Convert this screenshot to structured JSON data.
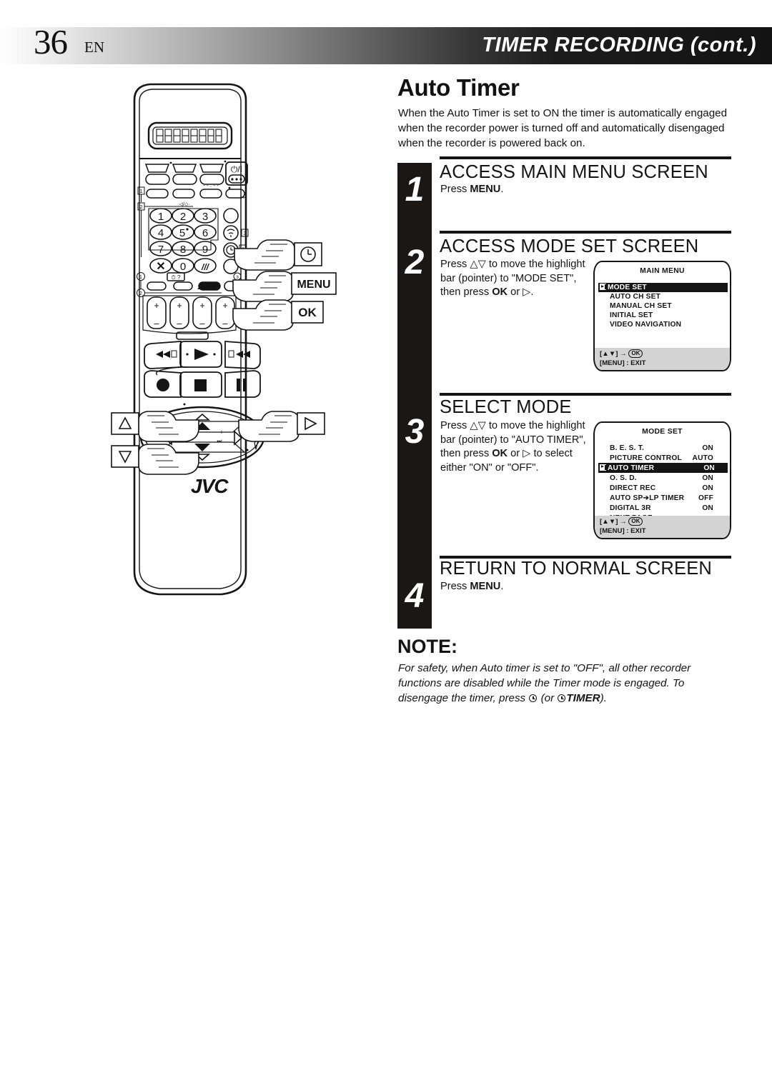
{
  "header": {
    "page_number": "36",
    "language": "EN",
    "title": "TIMER RECORDING (cont.)"
  },
  "section": {
    "title": "Auto Timer",
    "intro": "When the Auto Timer is set to ON the timer is automatically engaged when the recorder power is turned off and automatically disengaged when the recorder is powered back on."
  },
  "steps": [
    {
      "number": "1",
      "heading": "ACCESS MAIN MENU SCREEN",
      "body_html": "Press <b>MENU</b>."
    },
    {
      "number": "2",
      "heading": "ACCESS MODE SET SCREEN",
      "body_html": "Press &#9651;&#9661; to move the highlight bar (pointer) to \"MODE SET\", then press <b>OK</b> or &#9655;."
    },
    {
      "number": "3",
      "heading": "SELECT MODE",
      "body_html": "Press &#9651;&#9661; to move the highlight bar (pointer) to \"AUTO TIMER\", then press <b>OK</b> or &#9655; to select either \"ON\" or \"OFF\"."
    },
    {
      "number": "4",
      "heading": "RETURN TO NORMAL SCREEN",
      "body_html": "Press <b>MENU</b>."
    }
  ],
  "note": {
    "label": "NOTE:",
    "body_html": "For safety, when Auto timer is set to \"OFF\", all other recorder functions are disabled while the Timer mode is engaged. To disengage the timer, press <span class=\"inline-clock\"></span> (or <span class=\"inline-clock\"></span><b>TIMER</b>)."
  },
  "osd_screens": [
    {
      "id": "main-menu",
      "title": "MAIN MENU",
      "rows": [
        {
          "label": "MODE SET",
          "value": "",
          "highlight": true,
          "pointer": true
        },
        {
          "label": "AUTO CH SET",
          "value": "",
          "highlight": false
        },
        {
          "label": "MANUAL CH SET",
          "value": "",
          "highlight": false
        },
        {
          "label": "INITIAL SET",
          "value": "",
          "highlight": false
        },
        {
          "label": "VIDEO NAVIGATION",
          "value": "",
          "highlight": false
        }
      ],
      "footer": {
        "line1_prefix": "[",
        "line1_keys": "▲▼",
        "line1_mid": "] ",
        "line1_arrow": "→",
        "line1_ok": "OK",
        "line2": "[MENU] : EXIT"
      }
    },
    {
      "id": "mode-set",
      "title": "MODE SET",
      "rows": [
        {
          "label": "B. E. S. T.",
          "value": "ON",
          "highlight": false
        },
        {
          "label": "PICTURE CONTROL",
          "value": "AUTO",
          "highlight": false
        },
        {
          "label": "AUTO TIMER",
          "value": "ON",
          "highlight": true,
          "pointer": true
        },
        {
          "label": "O. S. D.",
          "value": "ON",
          "highlight": false
        },
        {
          "label": "DIRECT REC",
          "value": "ON",
          "highlight": false
        },
        {
          "label": "AUTO SP➔LP TIMER",
          "value": "OFF",
          "highlight": false
        },
        {
          "label": "DIGITAL 3R",
          "value": "ON",
          "highlight": false
        },
        {
          "label": "NEXT PAGE",
          "value": "",
          "highlight": false
        }
      ],
      "footer": {
        "line1_prefix": "[",
        "line1_keys": "▲▼",
        "line1_mid": "] ",
        "line1_arrow": "→",
        "line1_ok": "OK",
        "line2": "[MENU] : EXIT"
      }
    }
  ],
  "remote": {
    "brand": "JVC",
    "display_digits": "88888888",
    "power_label": "⏻/I",
    "timer_display_dashes": "- - : - -",
    "mute_label": "◁/◇",
    "keypad": [
      "1",
      "2",
      "3",
      "4",
      "5",
      "6",
      "7",
      "8",
      "9",
      "✕",
      "0",
      "///"
    ],
    "index_markers": [
      "1",
      "2",
      "3",
      "4"
    ],
    "circled_markers": [
      "1",
      "2",
      "3",
      "4"
    ],
    "volume_plus": "+",
    "volume_minus": "–",
    "nav_minus": "–",
    "nav_plus": "+",
    "callouts": [
      {
        "name": "timer-callout",
        "label": "clock-icon"
      },
      {
        "name": "menu-callout",
        "label": "MENU"
      },
      {
        "name": "ok-callout",
        "label": "OK"
      },
      {
        "name": "up-callout",
        "label": "△"
      },
      {
        "name": "down-callout",
        "label": "▽"
      },
      {
        "name": "right-callout",
        "label": "▷"
      }
    ]
  },
  "colors": {
    "ink": "#141414",
    "paper": "#ffffff",
    "osd_footer": "#d3d3d3",
    "rail": "#1a1715"
  }
}
